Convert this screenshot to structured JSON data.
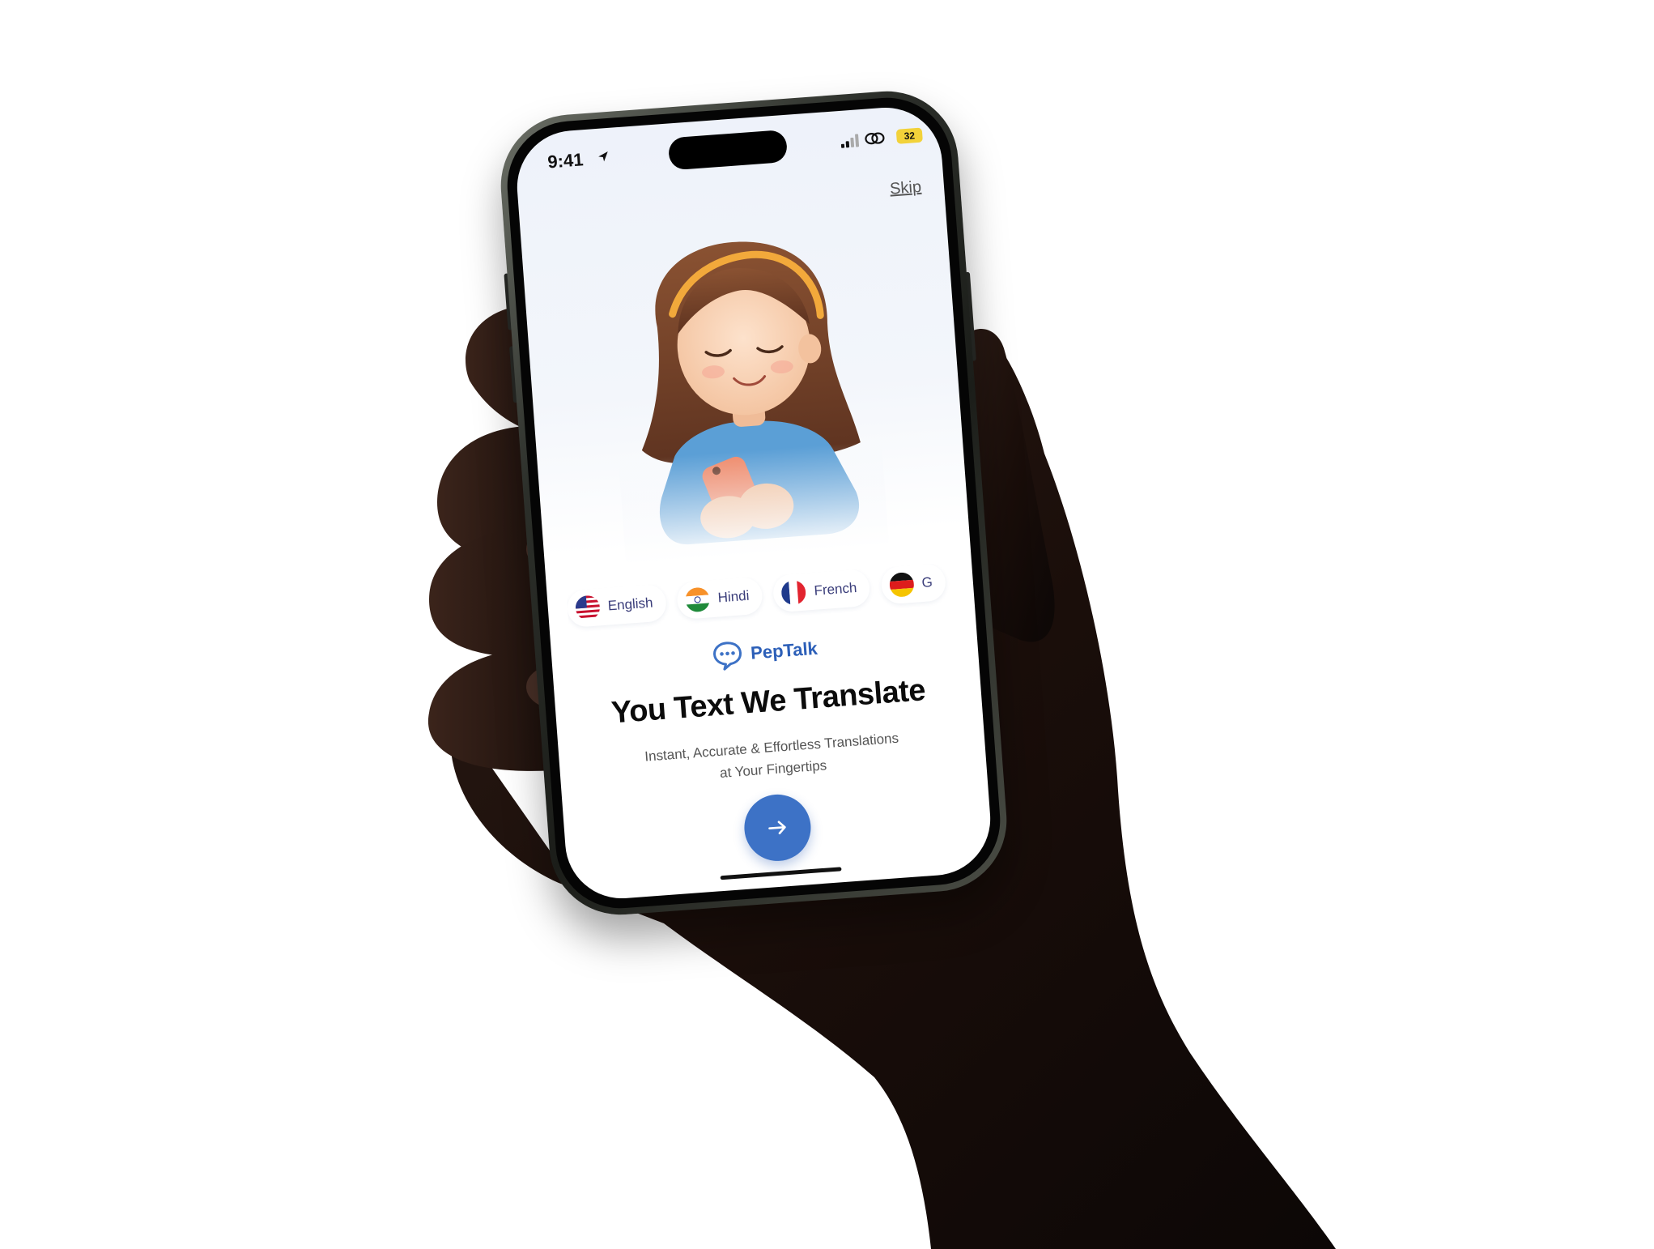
{
  "status_bar": {
    "time": "9:41",
    "battery": "32",
    "battery_color": "#f2d23a"
  },
  "onboarding": {
    "skip_label": "Skip",
    "languages": [
      {
        "label": "English",
        "flag": "us-flag-icon"
      },
      {
        "label": "Hindi",
        "flag": "india-flag-icon"
      },
      {
        "label": "French",
        "flag": "france-flag-icon"
      },
      {
        "label": "G",
        "flag": "germany-flag-icon"
      }
    ],
    "brand_name": "PepTalk",
    "headline": "You Text We Translate",
    "subtitle_line1": "Instant, Accurate & Effortless Translations",
    "subtitle_line2": "at Your Fingertips",
    "accent_color": "#3d72c6"
  }
}
